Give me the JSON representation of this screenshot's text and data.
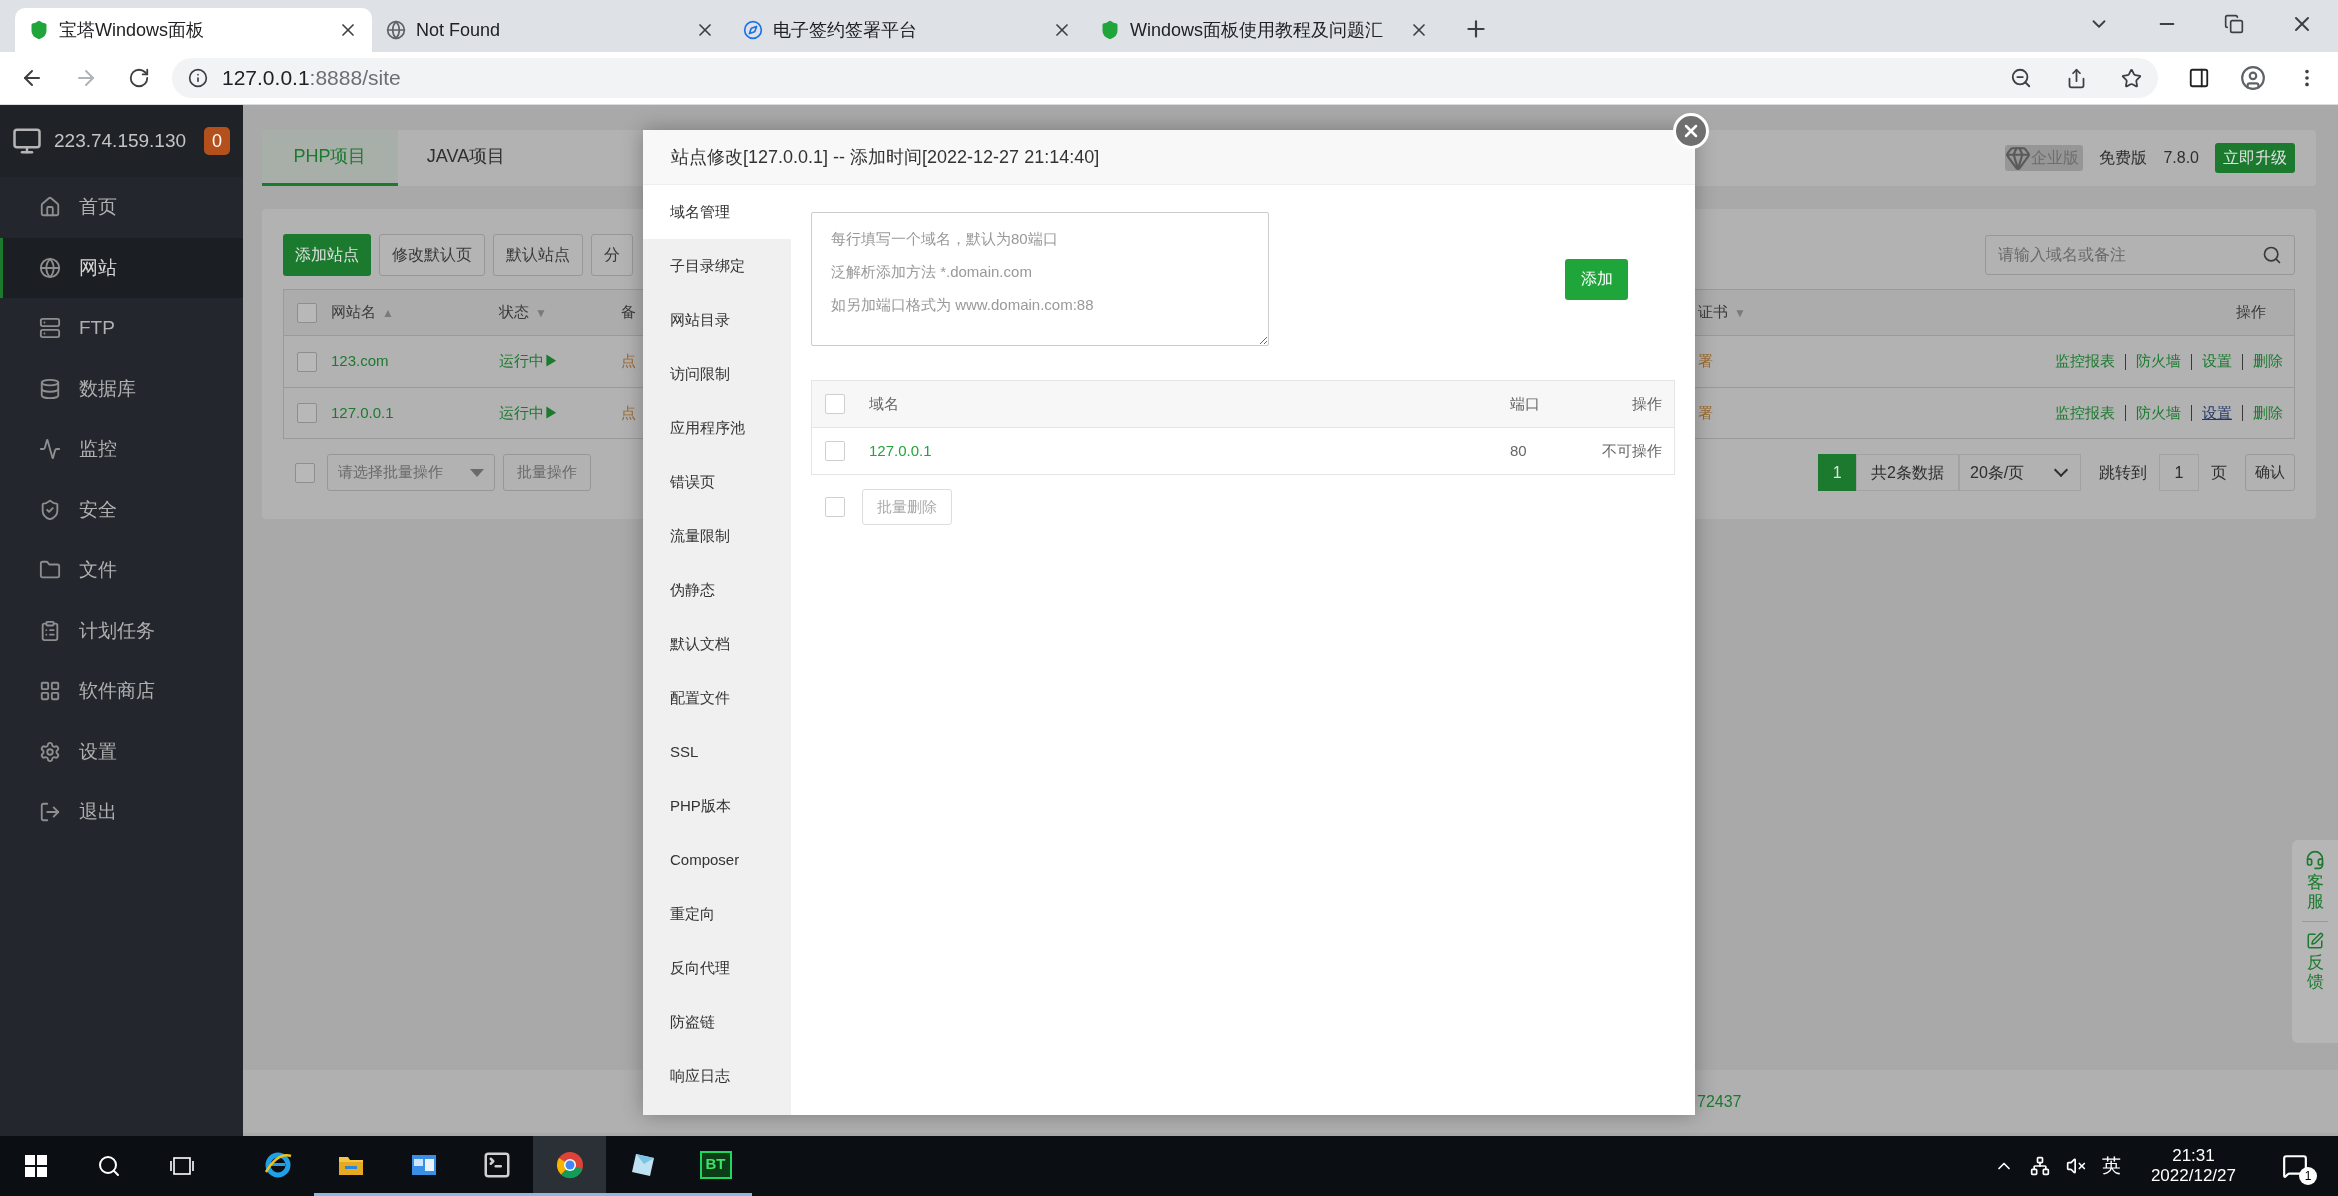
{
  "browser": {
    "tabs": [
      {
        "title": "宝塔Windows面板",
        "selected": true
      },
      {
        "title": "Not Found",
        "selected": false
      },
      {
        "title": "电子签约签署平台",
        "selected": false
      },
      {
        "title": "Windows面板使用教程及问题汇",
        "selected": false
      }
    ],
    "url": {
      "host": "127.0.0.1",
      "path": ":8888/site"
    }
  },
  "sidebar": {
    "server_ip": "223.74.159.130",
    "badge": "0",
    "items": [
      {
        "label": "首页",
        "selected": false
      },
      {
        "label": "网站",
        "selected": true
      },
      {
        "label": "FTP",
        "selected": false
      },
      {
        "label": "数据库",
        "selected": false
      },
      {
        "label": "监控",
        "selected": false
      },
      {
        "label": "安全",
        "selected": false
      },
      {
        "label": "文件",
        "selected": false
      },
      {
        "label": "计划任务",
        "selected": false
      },
      {
        "label": "软件商店",
        "selected": false
      },
      {
        "label": "设置",
        "selected": false
      },
      {
        "label": "退出",
        "selected": false
      }
    ]
  },
  "project_tabs": [
    {
      "label": "PHP项目",
      "selected": true
    },
    {
      "label": "JAVA项目",
      "selected": false
    }
  ],
  "edition": {
    "enterprise": "企业版",
    "free": "免费版",
    "version": "7.8.0",
    "upgrade": "立即升级"
  },
  "toolbar_buttons": [
    {
      "label": "添加站点",
      "kind": "primary"
    },
    {
      "label": "修改默认页",
      "kind": "default"
    },
    {
      "label": "默认站点",
      "kind": "default"
    },
    {
      "label": "分",
      "kind": "default"
    }
  ],
  "search": {
    "placeholder": "请输入域名或备注"
  },
  "sites_table": {
    "select_all_checked": false,
    "columns": [
      {
        "label": "网站名",
        "sort": "▲"
      },
      {
        "label": "状态",
        "sort": "▼"
      },
      {
        "label": "备"
      },
      {
        "label": "证书",
        "sort": "▼"
      },
      {
        "label": "操作"
      }
    ],
    "rows": [
      {
        "checked": false,
        "name": "123.com",
        "status": "运行中▶",
        "note": "点",
        "ssl": "署",
        "actions": [
          {
            "label": "监控报表",
            "hovered": false
          },
          {
            "label": "防火墙",
            "hovered": false
          },
          {
            "label": "设置",
            "hovered": false
          },
          {
            "label": "删除",
            "hovered": false
          }
        ]
      },
      {
        "checked": false,
        "name": "127.0.0.1",
        "status": "运行中▶",
        "note": "点",
        "ssl": "署",
        "actions": [
          {
            "label": "监控报表",
            "hovered": false
          },
          {
            "label": "防火墙",
            "hovered": false
          },
          {
            "label": "设置",
            "hovered": true
          },
          {
            "label": "删除",
            "hovered": false
          }
        ]
      }
    ]
  },
  "batch": {
    "checked": false,
    "placeholder": "请选择批量操作",
    "button": "批量操作"
  },
  "pagination": {
    "current": "1",
    "total": "共2条数据",
    "per_page": "20条/页",
    "goto_label": "跳转到",
    "goto_value": "1",
    "page_unit": "页",
    "confirm": "确认"
  },
  "footer": {
    "text": "72437"
  },
  "modal": {
    "title": "站点修改[127.0.0.1] -- 添加时间[2022-12-27 21:14:40]",
    "nav": [
      {
        "label": "域名管理",
        "selected": true
      },
      {
        "label": "子目录绑定",
        "selected": false
      },
      {
        "label": "网站目录",
        "selected": false
      },
      {
        "label": "访问限制",
        "selected": false
      },
      {
        "label": "应用程序池",
        "selected": false
      },
      {
        "label": "错误页",
        "selected": false
      },
      {
        "label": "流量限制",
        "selected": false
      },
      {
        "label": "伪静态",
        "selected": false
      },
      {
        "label": "默认文档",
        "selected": false
      },
      {
        "label": "配置文件",
        "selected": false
      },
      {
        "label": "SSL",
        "selected": false
      },
      {
        "label": "PHP版本",
        "selected": false
      },
      {
        "label": "Composer",
        "selected": false
      },
      {
        "label": "重定向",
        "selected": false
      },
      {
        "label": "反向代理",
        "selected": false
      },
      {
        "label": "防盗链",
        "selected": false
      },
      {
        "label": "响应日志",
        "selected": false
      }
    ],
    "domain_input": {
      "placeholder": [
        "每行填写一个域名，默认为80端口",
        "泛解析添加方法 *.domain.com",
        "如另加端口格式为 www.domain.com:88"
      ]
    },
    "add_button": "添加",
    "domain_table": {
      "select_all_checked": false,
      "columns": [
        "域名",
        "端口",
        "操作"
      ],
      "rows": [
        {
          "checked": false,
          "domain": "127.0.0.1",
          "port": "80",
          "action": "不可操作"
        }
      ]
    },
    "footer_checked": false,
    "batch_delete": "批量删除"
  },
  "side_widget": [
    "客服",
    "反馈"
  ],
  "taskbar": {
    "apps": [
      {
        "running": false,
        "selected": false
      },
      {
        "running": true,
        "selected": false
      },
      {
        "running": true,
        "selected": false
      },
      {
        "running": true,
        "selected": false
      },
      {
        "running": true,
        "selected": true
      },
      {
        "running": true,
        "selected": false
      },
      {
        "running": true,
        "selected": false,
        "label": "BT"
      }
    ],
    "ime": "英",
    "time": "21:31",
    "date": "2022/12/27",
    "notifications": "1"
  }
}
